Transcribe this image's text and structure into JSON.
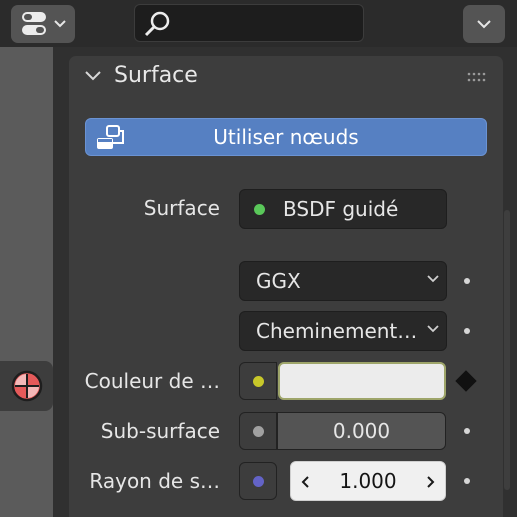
{
  "panel": {
    "title": "Surface",
    "use_nodes_label": "Utiliser nœuds"
  },
  "rows": {
    "surface_label": "Surface",
    "surface_value": "BSDF guidé",
    "distribution_value": "GGX",
    "subsurface_method_value": "Cheminement…",
    "base_color_label": "Couleur de …",
    "subsurface_label": "Sub-surface",
    "subsurface_value": "0.000",
    "radius_label": "Rayon de s…",
    "radius_value": "1.000"
  },
  "colors": {
    "surface_socket": "#5ac85a",
    "color_socket": "#c8c82a",
    "float_socket": "#a1a1a1",
    "vector_socket": "#6363c7",
    "accent": "#5680c2",
    "base_color": "#ececec"
  },
  "icons": {
    "editor_type": "properties-editor-icon",
    "search": "search-icon",
    "options": "chevron-down-icon",
    "material_tab": "material-icon",
    "collapse": "chevron-down-icon",
    "grip": "drag-handle-icon",
    "use_nodes": "node-tree-icon",
    "keyframe": "keyframe-diamond-icon"
  }
}
